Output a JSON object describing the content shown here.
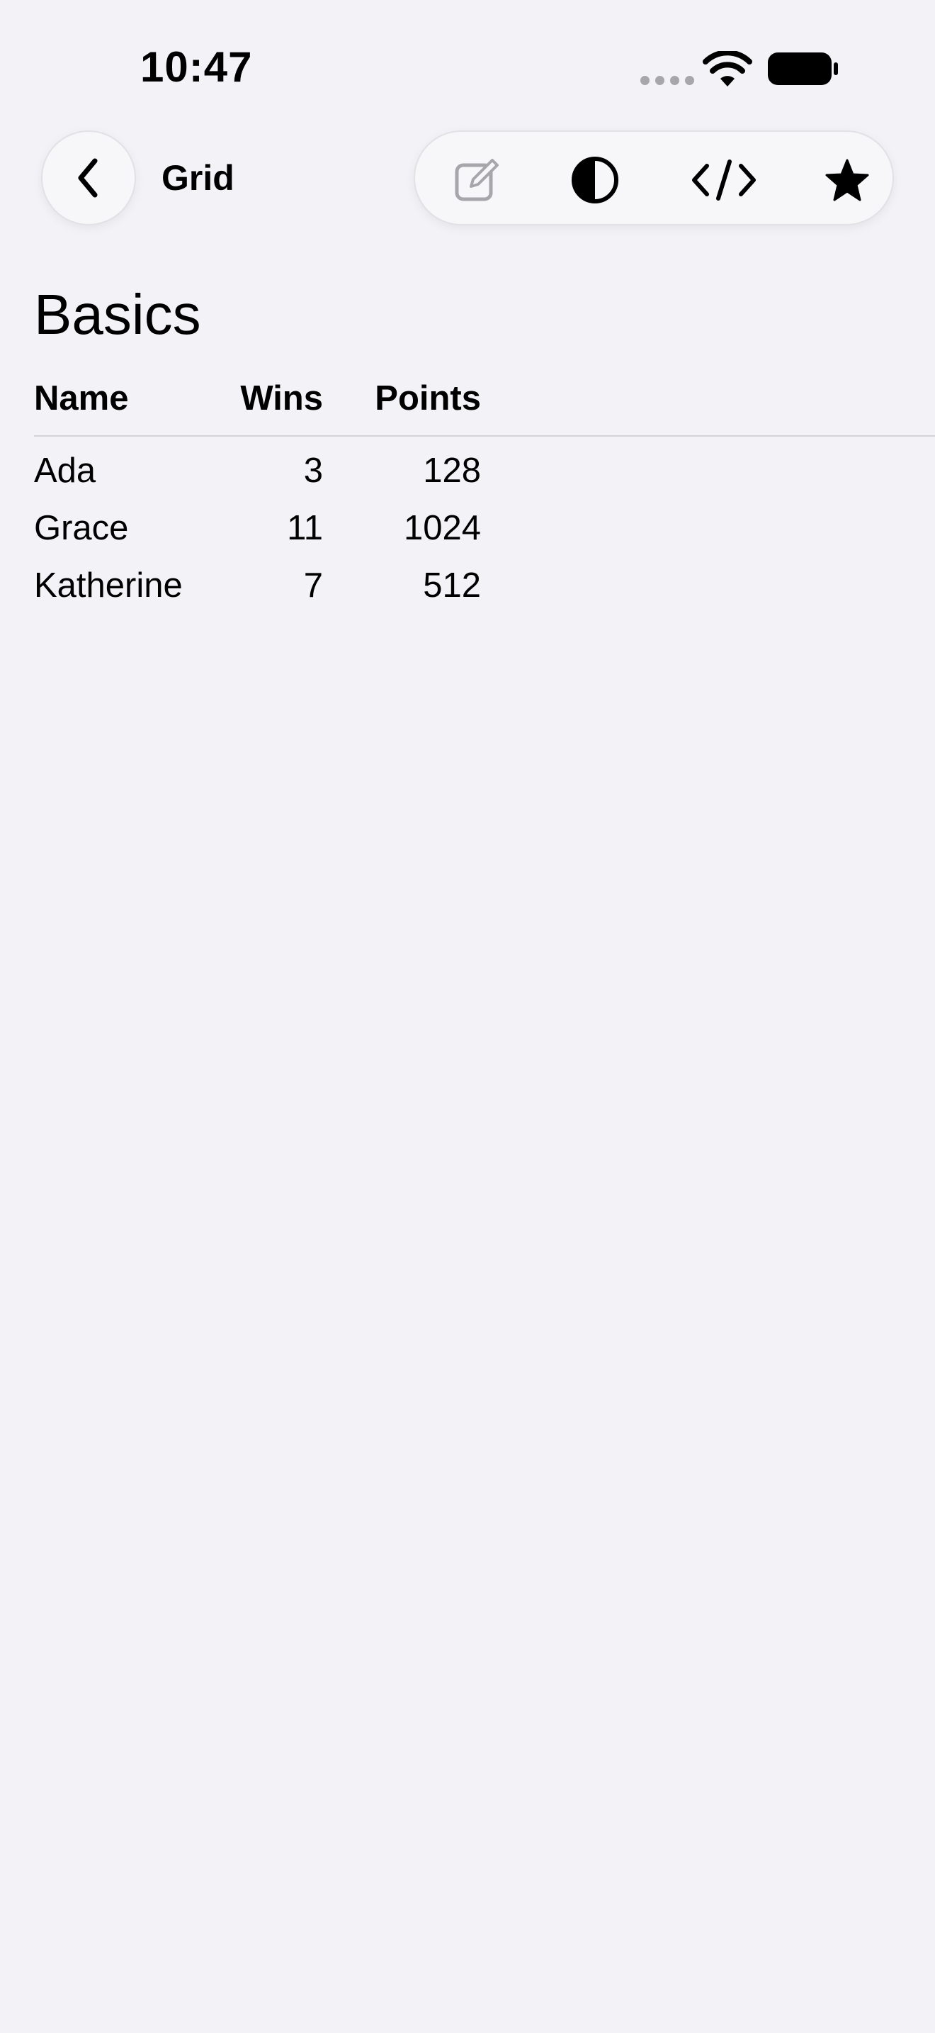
{
  "status": {
    "time": "10:47"
  },
  "nav": {
    "title": "Grid",
    "toolbar": [
      "edit-icon",
      "contrast-icon",
      "code-icon",
      "star-icon"
    ]
  },
  "section": {
    "title": "Basics"
  },
  "grid": {
    "headers": {
      "name": "Name",
      "wins": "Wins",
      "points": "Points"
    },
    "rows": [
      {
        "name": "Ada",
        "wins": "3",
        "points": "128"
      },
      {
        "name": "Grace",
        "wins": "11",
        "points": "1024"
      },
      {
        "name": "Katherine",
        "wins": "7",
        "points": "512"
      }
    ]
  },
  "colors": {
    "background": "#f2f2f7",
    "text": "#000000",
    "divider": "#d3d3d8",
    "inactive_icon": "#a7a7ab"
  }
}
